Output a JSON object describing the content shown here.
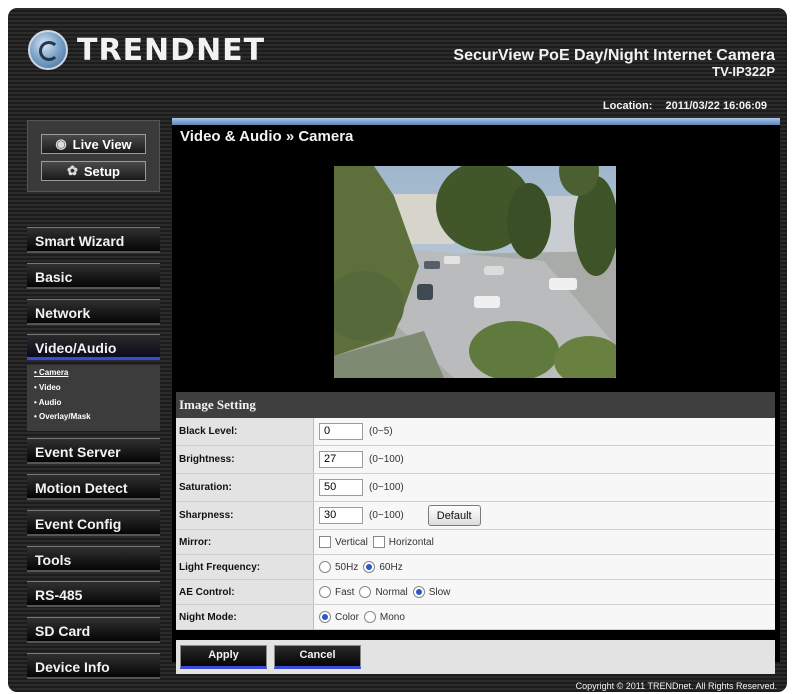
{
  "header": {
    "brand": "TRENDNET",
    "title": "SecurView PoE Day/Night Internet Camera",
    "model": "TV-IP322P",
    "location_label": "Location:",
    "datetime": "2011/03/22 16:06:09"
  },
  "top_buttons": {
    "live_view": "Live View",
    "setup": "Setup"
  },
  "sidebar": {
    "items": [
      {
        "label": "Smart Wizard"
      },
      {
        "label": "Basic"
      },
      {
        "label": "Network"
      },
      {
        "label": "Video/Audio"
      },
      {
        "label": "Event Server"
      },
      {
        "label": "Motion Detect"
      },
      {
        "label": "Event Config"
      },
      {
        "label": "Tools"
      },
      {
        "label": "RS-485"
      },
      {
        "label": "SD Card"
      },
      {
        "label": "Device Info"
      }
    ],
    "sub_items": [
      "• Camera",
      "• Video",
      "• Audio",
      "• Overlay/Mask"
    ],
    "active": "Video/Audio"
  },
  "main": {
    "title": "Video & Audio » Camera",
    "panel_title": "Image Setting",
    "fields": {
      "black_level": {
        "label": "Black Level:",
        "value": "0",
        "range": "(0~5)"
      },
      "brightness": {
        "label": "Brightness:",
        "value": "27",
        "range": "(0~100)"
      },
      "saturation": {
        "label": "Saturation:",
        "value": "50",
        "range": "(0~100)"
      },
      "sharpness": {
        "label": "Sharpness:",
        "value": "30",
        "range": "(0~100)",
        "default_button": "Default"
      },
      "mirror": {
        "label": "Mirror:",
        "vertical": "Vertical",
        "horizontal": "Horizontal"
      },
      "light_frequency": {
        "label": "Light Frequency:",
        "opt1": "50Hz",
        "opt2": "60Hz",
        "selected": "60Hz"
      },
      "ae_control": {
        "label": "AE Control:",
        "opt1": "Fast",
        "opt2": "Normal",
        "opt3": "Slow",
        "selected": "Slow"
      },
      "night_mode": {
        "label": "Night Mode:",
        "opt1": "Color",
        "opt2": "Mono",
        "selected": "Color"
      }
    },
    "apply": "Apply",
    "cancel": "Cancel"
  },
  "footer": {
    "copyright": "Copyright © 2011 TRENDnet. All Rights Reserved."
  },
  "colors": {
    "accent_blue": "#3b4bd9",
    "bar_blue": "#7fa5cc",
    "background": "#1e1e1e"
  }
}
